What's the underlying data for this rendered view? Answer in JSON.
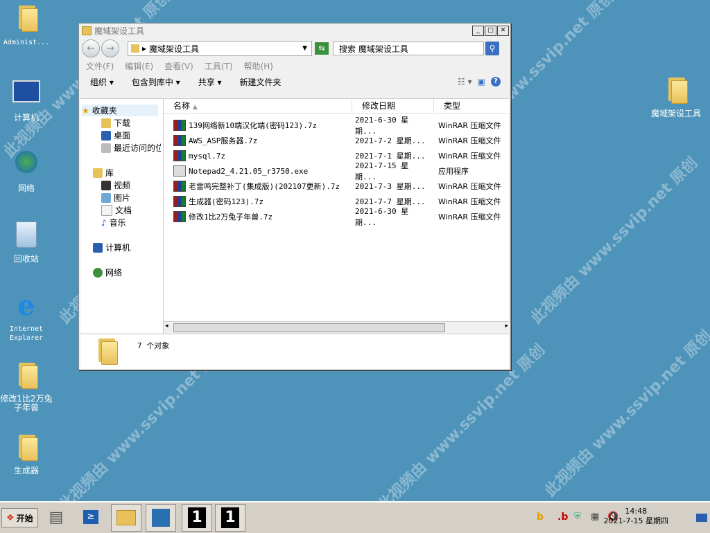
{
  "watermark": "此视频由 www.ssvip.net 原创",
  "desktop": {
    "icons": [
      {
        "id": "admin",
        "label": "Administ..."
      },
      {
        "id": "computer",
        "label": "计算机"
      },
      {
        "id": "network",
        "label": "网络"
      },
      {
        "id": "recycle",
        "label": "回收站"
      },
      {
        "id": "ie",
        "label": "Internet Explorer"
      },
      {
        "id": "mod",
        "label": "修改1比2万兔子年兽"
      },
      {
        "id": "gen",
        "label": "生成器"
      },
      {
        "id": "tools",
        "label": "魔域架设工具"
      }
    ]
  },
  "window": {
    "title": "魔域架设工具",
    "address": "魔域架设工具",
    "search_placeholder": "搜索 魔域架设工具",
    "menu": [
      "文件(F)",
      "编辑(E)",
      "查看(V)",
      "工具(T)",
      "帮助(H)"
    ],
    "commands": [
      "组织 ▾",
      "包含到库中 ▾",
      "共享 ▾",
      "新建文件夹"
    ],
    "nav": {
      "favorites": "收藏夹",
      "downloads": "下载",
      "desktop": "桌面",
      "recent": "最近访问的位置",
      "libraries": "库",
      "videos": "视频",
      "pictures": "图片",
      "documents": "文档",
      "music": "音乐",
      "computer": "计算机",
      "network": "网络"
    },
    "columns": [
      "名称",
      "修改日期",
      "类型"
    ],
    "files": [
      {
        "name": "139网络新10端汉化端(密码123).7z",
        "date": "2021-6-30 星期...",
        "type": "WinRAR 压缩文件",
        "kind": "rar"
      },
      {
        "name": "AWS_ASP服务器.7z",
        "date": "2021-7-2 星期...",
        "type": "WinRAR 压缩文件",
        "kind": "rar"
      },
      {
        "name": "mysql.7z",
        "date": "2021-7-1 星期...",
        "type": "WinRAR 压缩文件",
        "kind": "rar"
      },
      {
        "name": "Notepad2_4.21.05_r3750.exe",
        "date": "2021-7-15 星期...",
        "type": "应用程序",
        "kind": "exe"
      },
      {
        "name": "老雷鸣完整补丁(集成版)(202107更新).7z",
        "date": "2021-7-3 星期...",
        "type": "WinRAR 压缩文件",
        "kind": "rar"
      },
      {
        "name": "生成器(密码123).7z",
        "date": "2021-7-7 星期...",
        "type": "WinRAR 压缩文件",
        "kind": "rar"
      },
      {
        "name": "修改1比2万兔子年兽.7z",
        "date": "2021-6-30 星期...",
        "type": "WinRAR 压缩文件",
        "kind": "rar"
      }
    ],
    "status_count": "7 个对象"
  },
  "taskbar": {
    "start_label": "开始",
    "time": "14:48",
    "date": "2021-7-15 星期四"
  }
}
